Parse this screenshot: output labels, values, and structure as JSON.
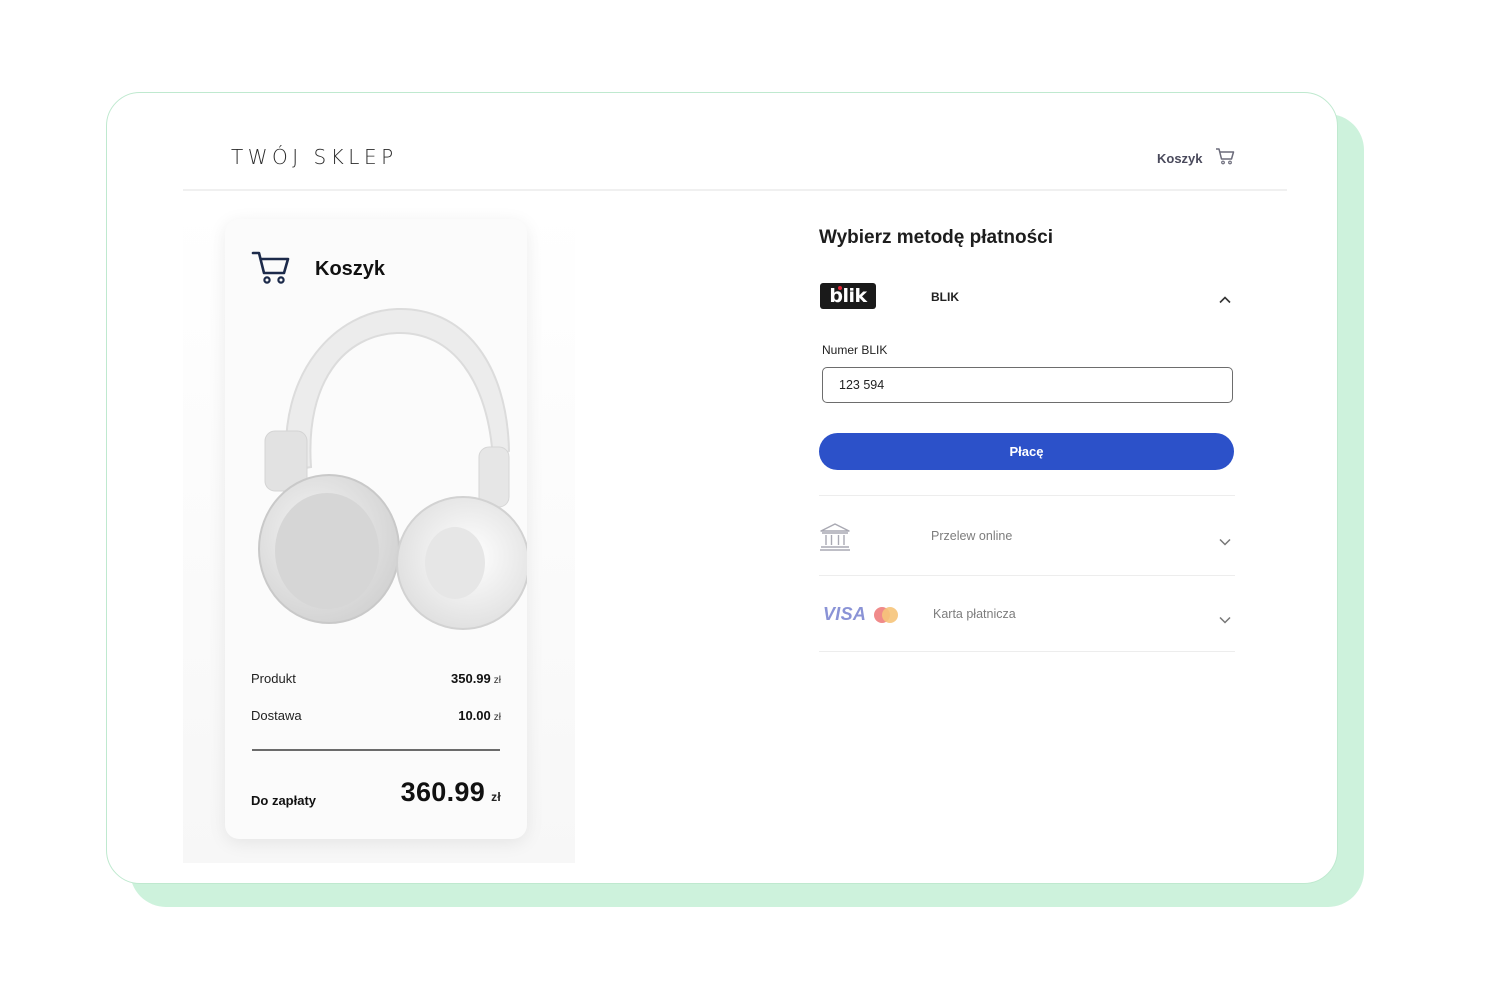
{
  "header": {
    "brand": "TWÓJ SKLEP",
    "cart_label": "Koszyk"
  },
  "cart": {
    "title": "Koszyk",
    "product_image": "white-headphones",
    "rows": [
      {
        "label": "Produkt",
        "value": "350.99",
        "currency": "zł"
      },
      {
        "label": "Dostawa",
        "value": "10.00",
        "currency": "zł"
      }
    ],
    "total": {
      "label": "Do zapłaty",
      "value": "360.99",
      "currency": "zł"
    }
  },
  "payment": {
    "title": "Wybierz metodę płatności",
    "blik": {
      "logo_text": "blik",
      "label": "BLIK",
      "field_label": "Numer BLIK",
      "field_value": "123 594",
      "button_label": "Płacę",
      "expanded": true
    },
    "methods": [
      {
        "label": "Przelew online",
        "icon": "bank-icon"
      },
      {
        "label": "Karta płatnicza",
        "icon": "card-brands-icon",
        "brand_text": "VISA"
      }
    ]
  },
  "colors": {
    "accent": "#2c51c9",
    "backdrop": "#cdf2dc",
    "blik_red": "#e02435"
  }
}
